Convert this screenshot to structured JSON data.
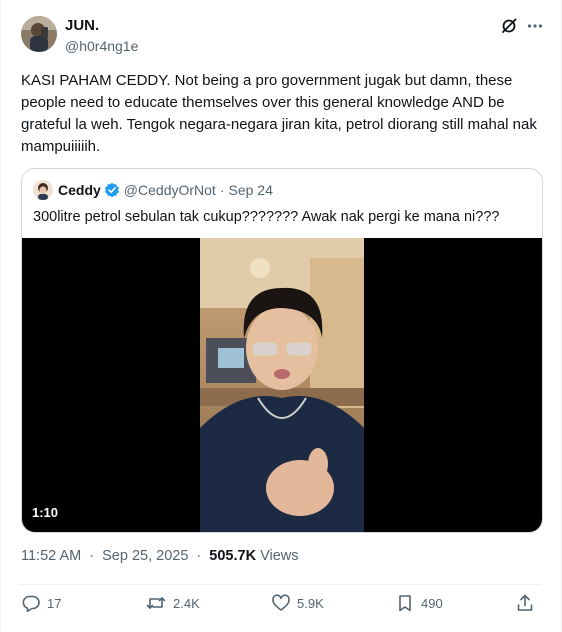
{
  "author": {
    "display_name": "JUN.",
    "handle": "@h0r4ng1e"
  },
  "tweet": {
    "text": "KASI PAHAM CEDDY. Not being a pro government jugak but damn, these people need to educate themselves over this general knowledge AND be grateful la weh. Tengok negara-negara jiran kita, petrol diorang still mahal nak mampuiiiiih."
  },
  "header_icons": [
    "grok-icon",
    "more-icon"
  ],
  "quoted": {
    "display_name": "Ceddy",
    "handle": "@CeddyOrNot",
    "separator": "·",
    "date": "Sep 24",
    "text": "300litre petrol sebulan tak cukup??????? Awak nak pergi ke mana ni???",
    "video_duration": "1:10"
  },
  "meta": {
    "time": "11:52 AM",
    "date": "Sep 25, 2025",
    "views_count": "505.7K",
    "views_label": "Views",
    "dot": "·"
  },
  "actions": {
    "replies": "17",
    "reposts": "2.4K",
    "likes": "5.9K",
    "bookmarks": "490"
  },
  "colors": {
    "text": "#0f1419",
    "secondary": "#536471",
    "border": "#cfd9de",
    "verified": "#1d9bf0"
  }
}
